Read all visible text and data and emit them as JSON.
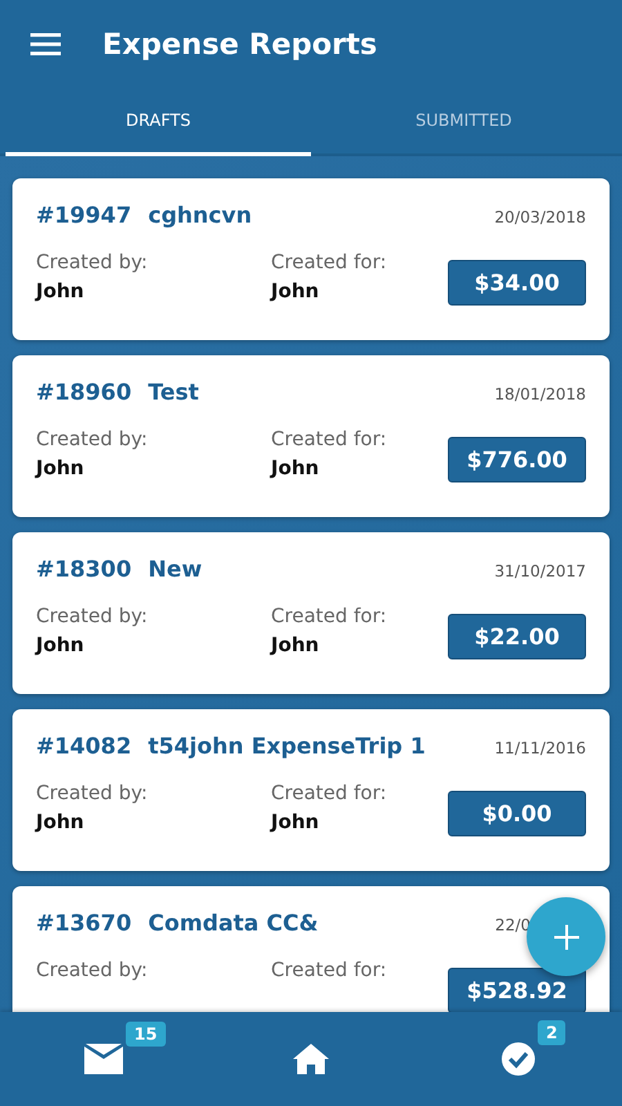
{
  "app_bar": {
    "title": "Expense Reports"
  },
  "tabs": [
    {
      "label": "DRAFTS",
      "selected": true
    },
    {
      "label": "SUBMITTED",
      "selected": false
    }
  ],
  "reports": [
    {
      "number": "#19947",
      "name": "cghncvn",
      "date": "20/03/2018",
      "created_by_label": "Created by:",
      "created_by": "John",
      "created_for_label": "Created for:",
      "created_for": "John",
      "amount": "$34.00"
    },
    {
      "number": "#18960",
      "name": "Test",
      "date": "18/01/2018",
      "created_by_label": "Created by:",
      "created_by": "John",
      "created_for_label": "Created for:",
      "created_for": "John",
      "amount": "$776.00"
    },
    {
      "number": "#18300",
      "name": "New",
      "date": "31/10/2017",
      "created_by_label": "Created by:",
      "created_by": "John",
      "created_for_label": "Created for:",
      "created_for": "John",
      "amount": "$22.00"
    },
    {
      "number": "#14082",
      "name": "t54john ExpenseTrip 1",
      "date": "11/11/2016",
      "created_by_label": "Created by:",
      "created_by": "John",
      "created_for_label": "Created for:",
      "created_for": "John",
      "amount": "$0.00"
    },
    {
      "number": "#13670",
      "name": "Comdata CC&",
      "date": "22/0",
      "created_by_label": "Created by:",
      "created_for_label": "Created for:",
      "amount": "$528.92"
    }
  ],
  "bottom_nav": [
    {
      "kind": "mail",
      "badge": "15"
    },
    {
      "kind": "home"
    },
    {
      "kind": "check",
      "badge": "2"
    }
  ]
}
